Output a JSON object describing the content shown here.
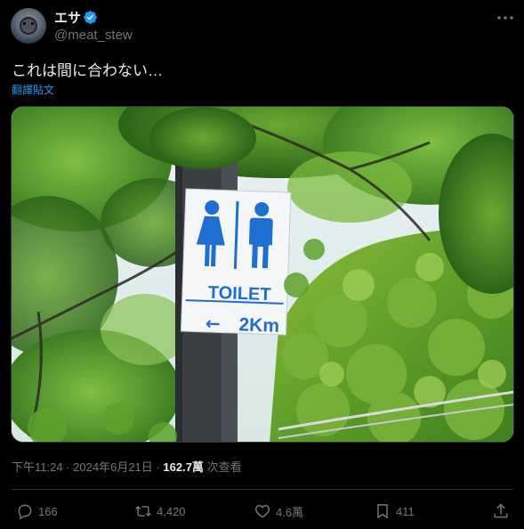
{
  "author": {
    "display_name": "エサ",
    "handle": "@meat_stew"
  },
  "post": {
    "text": "これは間に合わない…",
    "translate_label": "翻譯貼文"
  },
  "media": {
    "sign_text": "TOILET",
    "sign_arrow": "←",
    "sign_distance": "2Km"
  },
  "meta": {
    "time": "下午11:24",
    "separator": "·",
    "date": "2024年6月21日",
    "views_count": "162.7萬",
    "views_label": "次查看"
  },
  "actions": {
    "reply_count": "166",
    "repost_count": "4,420",
    "like_count": "4.6萬",
    "bookmark_count": "411"
  },
  "colors": {
    "background": "#000000",
    "text_primary": "#e7e9ea",
    "text_secondary": "#71767b",
    "accent": "#1d9bf0",
    "sign_blue": "#1f6fd1"
  }
}
